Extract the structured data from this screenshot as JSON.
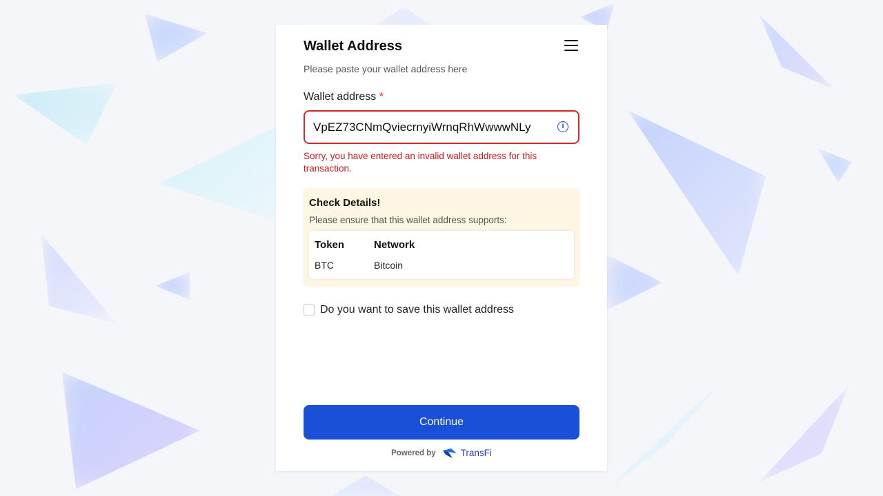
{
  "header": {
    "title": "Wallet Address",
    "subtitle": "Please paste your wallet address here"
  },
  "wallet_field": {
    "label": "Wallet address",
    "required_marker": "*",
    "value": "VpEZ73CNmQviecrnyiWrnqRhWwwwNLy",
    "error": "Sorry, you have entered an invalid wallet address for this transaction."
  },
  "check_details": {
    "title": "Check Details!",
    "description": "Please ensure that this wallet address supports:",
    "columns": [
      "Token",
      "Network"
    ],
    "rows": [
      {
        "token": "BTC",
        "network": "Bitcoin"
      }
    ]
  },
  "save_option": {
    "label": "Do you want to save this wallet address",
    "checked": false
  },
  "actions": {
    "continue_label": "Continue"
  },
  "footer": {
    "powered_by": "Powered by",
    "brand": "TransFi"
  },
  "colors": {
    "primary": "#1a4fd8",
    "error": "#d0181d",
    "check_bg": "#fdf6e3"
  },
  "icons": {
    "menu": "hamburger-menu-icon",
    "info": "info-circle-icon",
    "brand": "transfi-logo-icon"
  }
}
